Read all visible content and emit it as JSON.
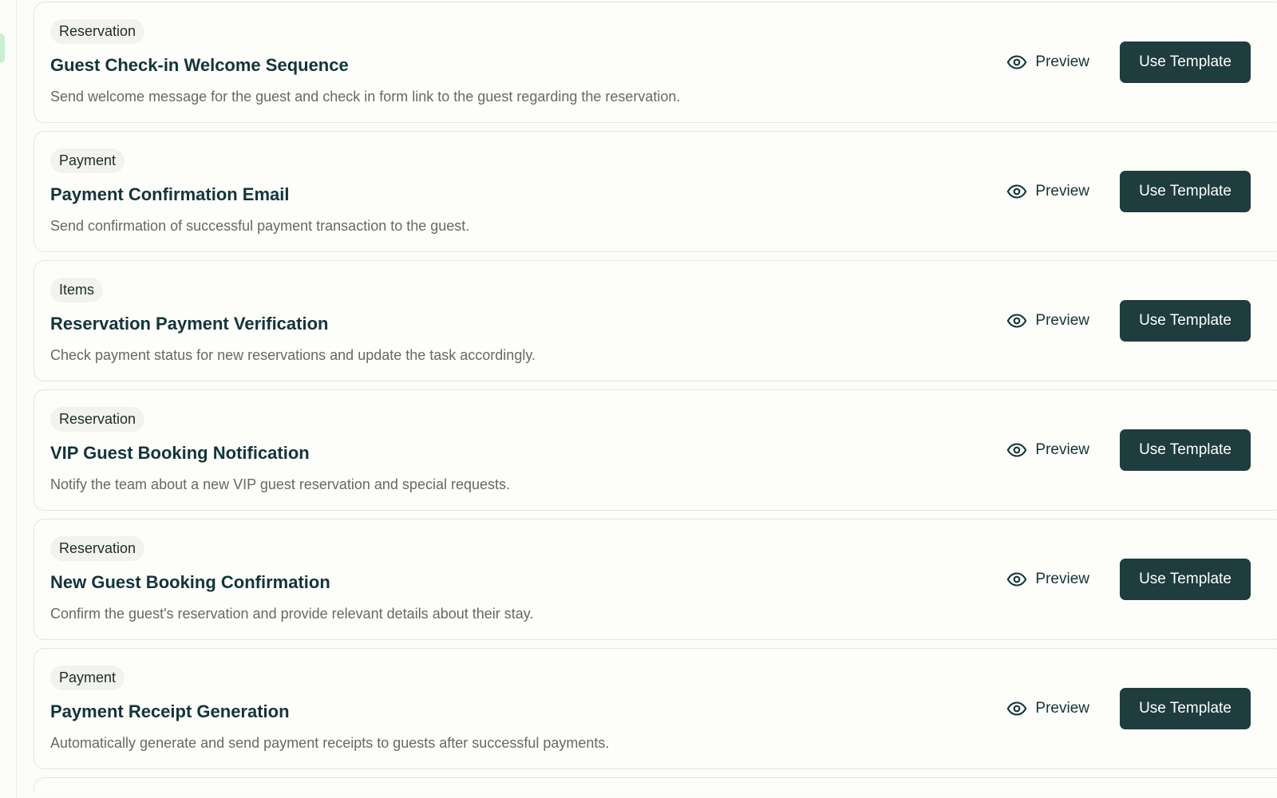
{
  "templates": [
    {
      "category": "Reservation",
      "title": "Guest Check-in Welcome Sequence",
      "description": "Send welcome message for the guest and check in form link to the guest regarding the reservation.",
      "preview_label": "Preview",
      "use_label": "Use Template"
    },
    {
      "category": "Payment",
      "title": "Payment Confirmation Email",
      "description": "Send confirmation of successful payment transaction to the guest.",
      "preview_label": "Preview",
      "use_label": "Use Template"
    },
    {
      "category": "Items",
      "title": "Reservation Payment Verification",
      "description": "Check payment status for new reservations and update the task accordingly.",
      "preview_label": "Preview",
      "use_label": "Use Template"
    },
    {
      "category": "Reservation",
      "title": "VIP Guest Booking Notification",
      "description": "Notify the team about a new VIP guest reservation and special requests.",
      "preview_label": "Preview",
      "use_label": "Use Template"
    },
    {
      "category": "Reservation",
      "title": "New Guest Booking Confirmation",
      "description": "Confirm the guest's reservation and provide relevant details about their stay.",
      "preview_label": "Preview",
      "use_label": "Use Template"
    },
    {
      "category": "Payment",
      "title": "Payment Receipt Generation",
      "description": "Automatically generate and send payment receipts to guests after successful payments.",
      "preview_label": "Preview",
      "use_label": "Use Template"
    }
  ],
  "icons": {
    "preview": "eye-icon"
  },
  "colors": {
    "page_background": "#fcfcf8",
    "card_background": "#fdfdf9",
    "card_border": "#e6e6e0",
    "primary_button": "#1f3c3e",
    "text_primary": "#13343b",
    "text_secondary": "#666966",
    "badge_background": "#f2f2ee",
    "sidebar_accent": "#c6f0cf"
  }
}
